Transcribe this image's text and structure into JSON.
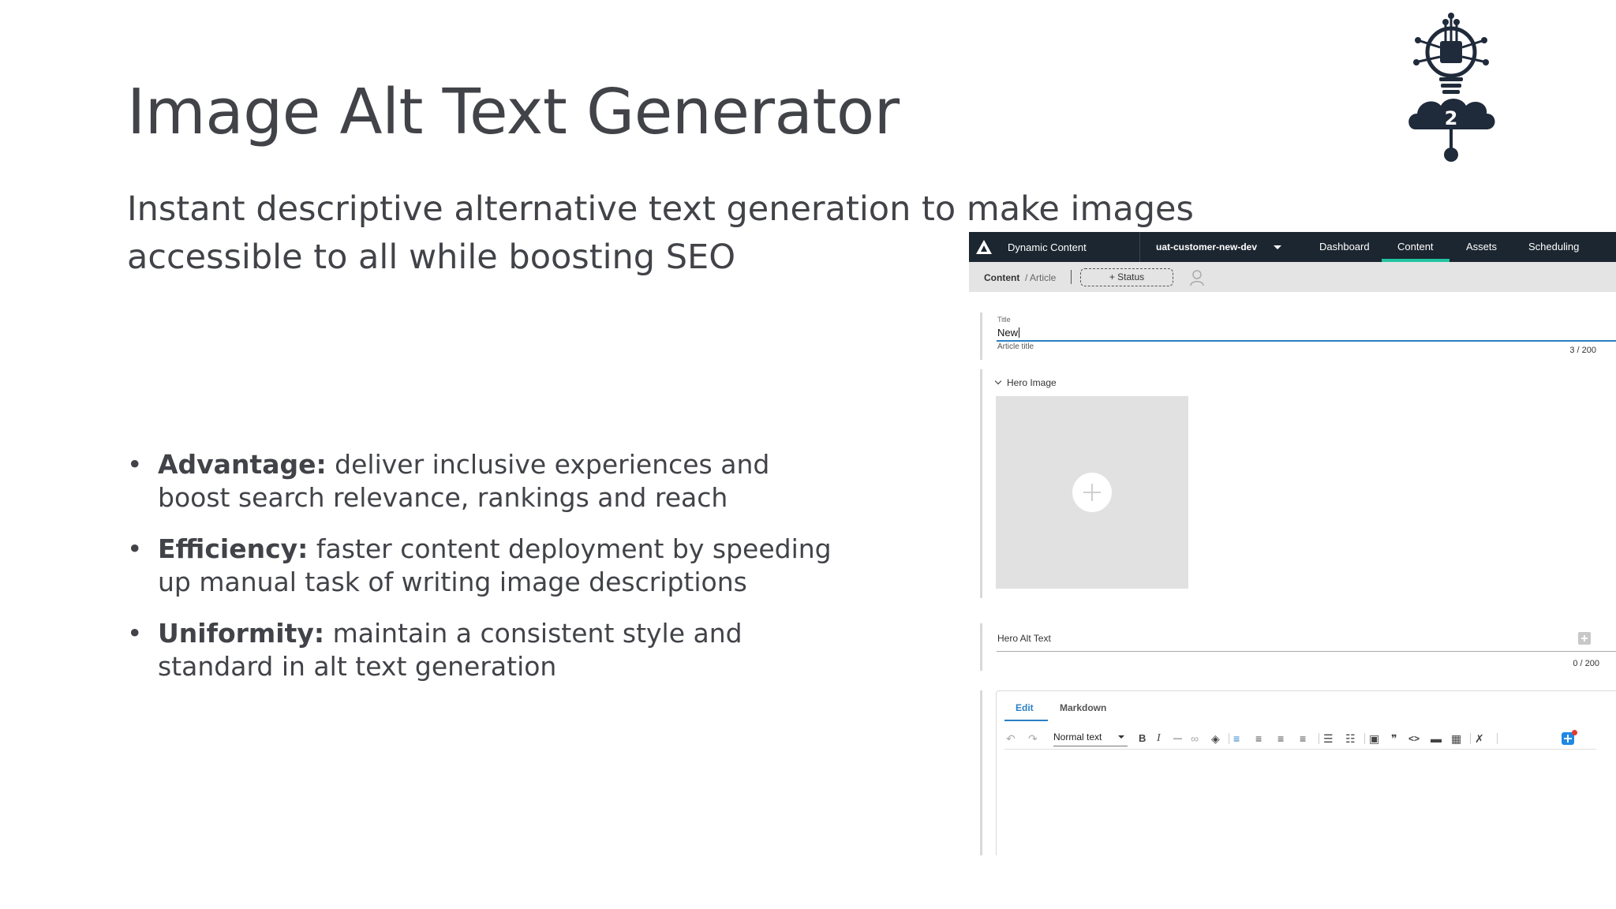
{
  "slide": {
    "title": "Image Alt Text Generator",
    "subtitle_line1": "Instant descriptive alternative text generation to make images",
    "subtitle_line2": "accessible to all while boosting SEO",
    "bullets": [
      {
        "label": "Advantage:",
        "line1": " deliver inclusive experiences and",
        "line2": "boost search relevance, rankings and reach"
      },
      {
        "label": "Efficiency:",
        "line1": " faster content deployment by speeding",
        "line2": "up manual task of writing image descriptions"
      },
      {
        "label": "Uniformity:",
        "line1": " maintain a consistent style and",
        "line2": "standard in alt text generation"
      }
    ],
    "logo": {
      "icon": "ai-chip-lightbulb-icon",
      "number": "2"
    },
    "colors": {
      "text": "#414348",
      "logo": "#1f2a3a"
    }
  },
  "app": {
    "topbar": {
      "app_name": "Dynamic Content",
      "account": "uat-customer-new-dev",
      "nav": [
        "Dashboard",
        "Content",
        "Assets",
        "Scheduling"
      ],
      "active_nav": "Content"
    },
    "breadcrumb": {
      "root": "Content",
      "sub": "/ Article",
      "status_button": "+ Status"
    },
    "title_field": {
      "label": "Title",
      "value": "New",
      "helper": "Article title",
      "counter": "3 / 200"
    },
    "hero": {
      "section_label": "Hero Image"
    },
    "alt_field": {
      "label": "Hero Alt Text",
      "counter": "0 / 200"
    },
    "editor": {
      "tabs": [
        "Edit",
        "Markdown"
      ],
      "active_tab": "Edit",
      "format_select": "Normal text",
      "toolbar_glyphs": {
        "bold": "B",
        "italic": "I",
        "hr": "—",
        "quote": "❞",
        "code": "<>"
      }
    },
    "colors": {
      "topbar": "#1c2630",
      "active_nav": "#22c3a0",
      "accent": "#2a7fc4",
      "dropzone": "#e1e1e1"
    }
  }
}
